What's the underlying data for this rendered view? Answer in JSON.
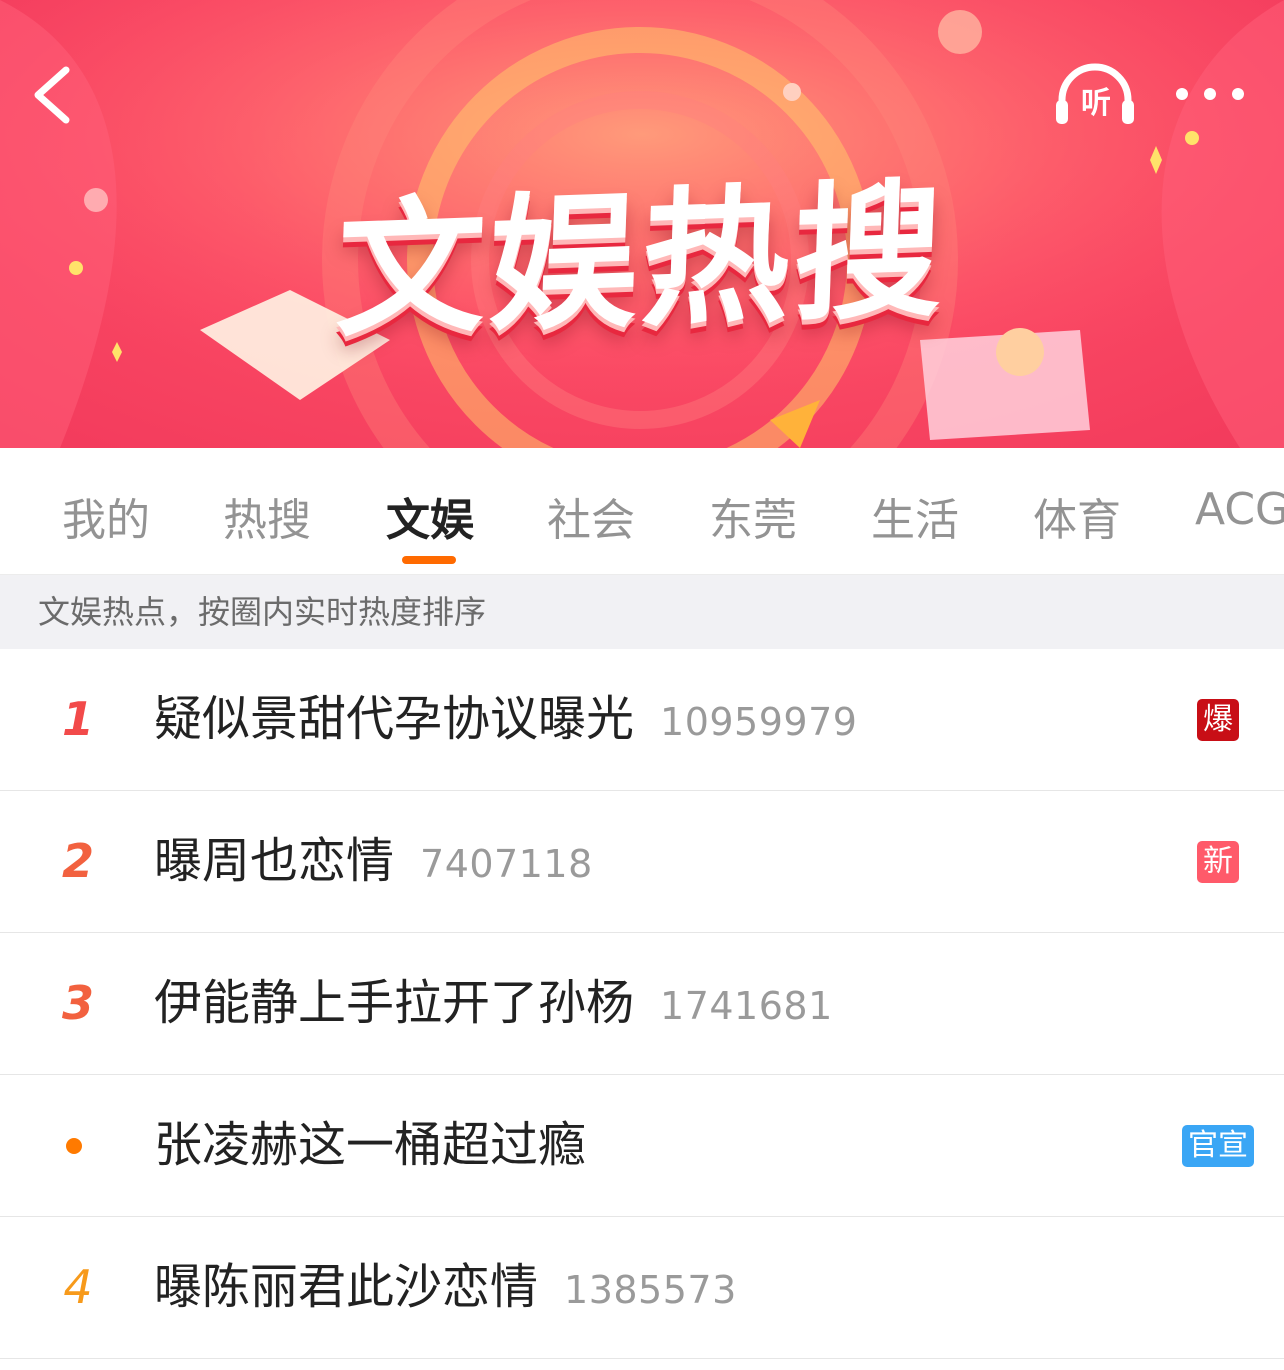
{
  "banner": {
    "title": "文娱热搜",
    "listen_label": "听"
  },
  "tabs": [
    {
      "label": "我的"
    },
    {
      "label": "热搜"
    },
    {
      "label": "文娱"
    },
    {
      "label": "社会"
    },
    {
      "label": "东莞"
    },
    {
      "label": "生活"
    },
    {
      "label": "体育"
    },
    {
      "label": "ACG"
    }
  ],
  "active_tab": "文娱",
  "hint": "文娱热点，按圈内实时热度排序",
  "list": [
    {
      "rank": "1",
      "title": "疑似景甜代孕协议曝光",
      "count": "10959979",
      "badge": "爆"
    },
    {
      "rank": "2",
      "title": "曝周也恋情",
      "count": "7407118",
      "badge": "新"
    },
    {
      "rank": "3",
      "title": "伊能静上手拉开了孙杨",
      "count": "1741681",
      "badge": ""
    },
    {
      "rank": "",
      "title": "张凌赫这一桶超过瘾",
      "count": "",
      "badge": "官宣"
    },
    {
      "rank": "4",
      "title": "曝陈丽君此沙恋情",
      "count": "1385573",
      "badge": ""
    }
  ],
  "colors": {
    "accent": "#ff6a00",
    "badge_bao": "#c80e16",
    "badge_xin": "#ff5a6a",
    "badge_guan": "#3aa6f5",
    "banner": "#f23a5c"
  }
}
